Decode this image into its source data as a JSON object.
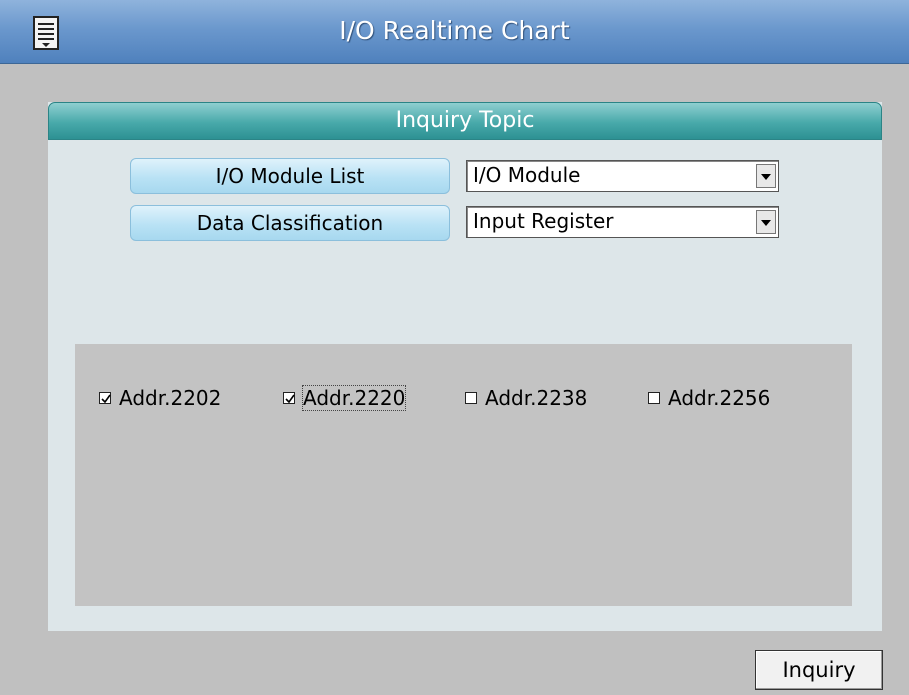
{
  "window": {
    "title": "I/O Realtime Chart",
    "menu_icon": "list-menu-icon"
  },
  "panel": {
    "header": "Inquiry Topic",
    "module_list_label": "I/O Module List",
    "data_class_label": "Data Classification",
    "module_select": {
      "value": "I/O Module"
    },
    "data_class_select": {
      "value": "Input Register"
    }
  },
  "addresses": [
    {
      "label": "Addr.2202",
      "checked": true
    },
    {
      "label": "Addr.2220",
      "checked": true
    },
    {
      "label": "Addr.2238",
      "checked": false
    },
    {
      "label": "Addr.2256",
      "checked": false
    }
  ],
  "footer": {
    "inquiry_label": "Inquiry"
  },
  "colors": {
    "titlebar": "#4f81bd",
    "panel_header": "#48a9aa",
    "label_button": "#b9e2f5",
    "panel_bg": "#dde6e9"
  }
}
